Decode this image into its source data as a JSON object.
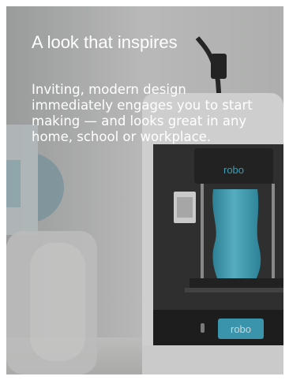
{
  "card": {
    "title": "A look that inspires",
    "description": "Inviting, modern design immediately engages you to start making — and looks great in any home, school or workplace."
  },
  "photo": {
    "printer_brand": "robo",
    "printer_panel_label": "robo",
    "printed_object_color": "#3fb3cc",
    "accent_color": "#2aa7c4"
  }
}
